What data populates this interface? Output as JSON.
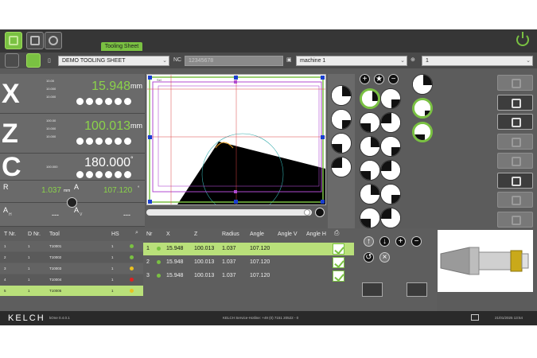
{
  "tab_tooltip": "Tooling Sheet",
  "sheet": {
    "name": "DEMO TOOLING SHEET",
    "nc_label": "NC",
    "nc_value": "12345678",
    "machine": "machine 1",
    "slot": "1"
  },
  "axes": [
    {
      "letter": "X",
      "value": "15.948",
      "unit": "mm",
      "sub": [
        "10.00",
        "10.000",
        "10.000"
      ]
    },
    {
      "letter": "Z",
      "value": "100.013",
      "unit": "mm",
      "sub": [
        "100.00",
        "10.000",
        "10.000"
      ]
    },
    {
      "letter": "C",
      "value": "180.000",
      "unit": "°",
      "sub": [
        "100.000"
      ]
    }
  ],
  "extra": {
    "r_label": "R",
    "r_value": "1.037",
    "r_unit": "mm",
    "a_label": "A",
    "a_value": "107.120",
    "a_unit": "°",
    "ah_label": "A",
    "ah_sub": "H",
    "ah_value": "---",
    "av_label": "A",
    "av_sub": "V",
    "av_value": "---"
  },
  "tools_table": {
    "headers": [
      "T Nr.",
      "D Nr.",
      "Tool",
      "HS"
    ],
    "rows": [
      {
        "t": "1",
        "d": "1",
        "tool": "T10001",
        "hs": "1",
        "dot": "#7ac142"
      },
      {
        "t": "2",
        "d": "1",
        "tool": "T10002",
        "hs": "1",
        "dot": "#7ac142"
      },
      {
        "t": "3",
        "d": "1",
        "tool": "T10003",
        "hs": "1",
        "dot": "#e8c020"
      },
      {
        "t": "4",
        "d": "1",
        "tool": "T10004",
        "hs": "1",
        "dot": "#e02020"
      },
      {
        "t": "5",
        "d": "1",
        "tool": "T10005",
        "hs": "1",
        "dot": "#e8c020"
      }
    ]
  },
  "meas_table": {
    "headers": [
      "Nr",
      "X",
      "Z",
      "Radius",
      "Angle",
      "Angle V",
      "Angle H"
    ],
    "rows": [
      {
        "nr": "1",
        "x": "15.948",
        "z": "100.013",
        "radius": "1.037",
        "angle": "107.120"
      },
      {
        "nr": "2",
        "x": "15.948",
        "z": "100.013",
        "radius": "1.037",
        "angle": "107.120"
      },
      {
        "nr": "3",
        "x": "15.948",
        "z": "100.013",
        "radius": "1.037",
        "angle": "107.120"
      }
    ]
  },
  "canvas_label": "Sel",
  "status": {
    "brand": "KELCH",
    "app": "kOne  0.4.0.1",
    "hotline": "KELCH Service-Hotline: +49 (0) 7151 20522 - 0",
    "datetime": "21/01/2025 13:54"
  },
  "colors": {
    "accent": "#7ac142",
    "dark": "#363636",
    "panel": "#5c5c5c"
  }
}
